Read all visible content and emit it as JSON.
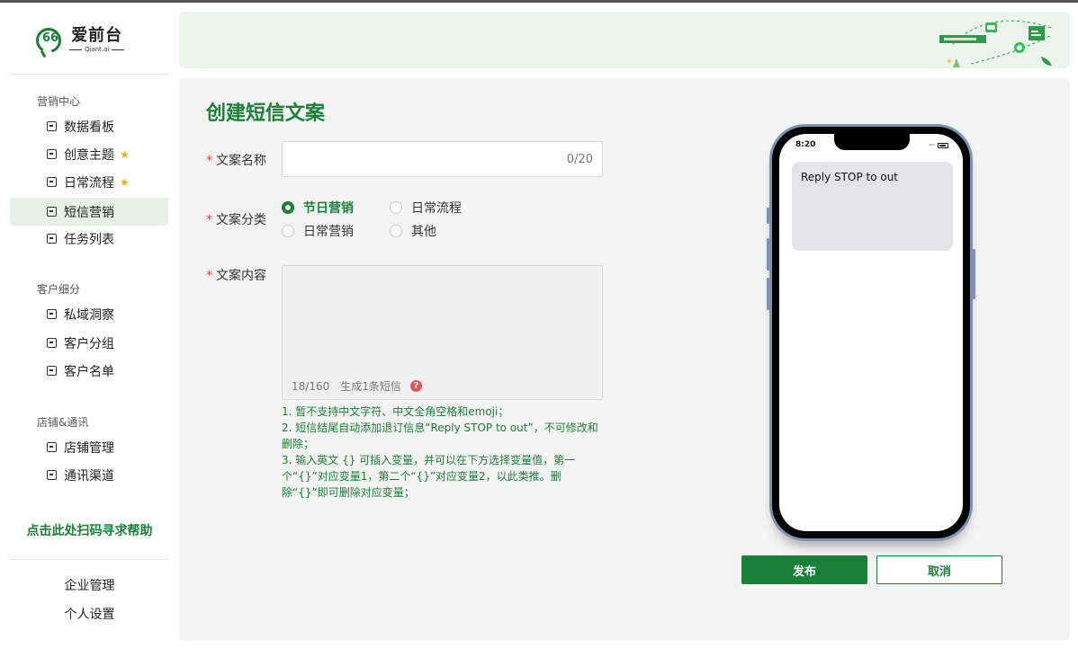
{
  "app": {
    "logo_cn": "爱前台",
    "logo_en": "Qiant.ai",
    "logo_mark": "66"
  },
  "sidebar": {
    "sections": [
      {
        "title": "营销中心",
        "items": [
          {
            "label": "数据看板",
            "icon": "dashboard-icon",
            "starred": false,
            "active": false
          },
          {
            "label": "创意主题",
            "icon": "image-icon",
            "starred": true,
            "active": false
          },
          {
            "label": "日常流程",
            "icon": "calendar-icon",
            "starred": true,
            "active": false
          },
          {
            "label": "短信营销",
            "icon": "sms-icon",
            "starred": false,
            "active": true
          },
          {
            "label": "任务列表",
            "icon": "tasklist-icon",
            "starred": false,
            "active": false
          }
        ]
      },
      {
        "title": "客户细分",
        "items": [
          {
            "label": "私域洞察",
            "icon": "insight-icon"
          },
          {
            "label": "客户分组",
            "icon": "group-icon"
          },
          {
            "label": "客户名单",
            "icon": "customer-list-icon"
          }
        ]
      },
      {
        "title": "店铺&通讯",
        "items": [
          {
            "label": "店铺管理",
            "icon": "store-icon"
          },
          {
            "label": "通讯渠道",
            "icon": "channel-icon"
          }
        ]
      }
    ],
    "help_link": "点击此处扫码寻求帮助",
    "bottom_items": [
      "企业管理",
      "个人设置"
    ]
  },
  "form": {
    "title": "创建短信文案",
    "name_label": "文案名称",
    "name_value": "",
    "name_counter": "0/20",
    "category_label": "文案分类",
    "category_options": [
      "节日营销",
      "日常流程",
      "日常营销",
      "其他"
    ],
    "category_selected": "节日营销",
    "content_label": "文案内容",
    "content_value": "",
    "content_counter": "18/160",
    "content_sms_count": "生成1条短信",
    "notes": [
      "1. 暂不支持中文字符、中文全角空格和emoji；",
      "2. 短信结尾自动添加退订信息“Reply STOP to out”，不可修改和删除；",
      "3. 输入英文 {} 可插入变量，并可以在下方选择变量值，第一个“{}”对应变量1，第二个“{}”对应变量2，以此类推。删除“{}”即可删除对应变量；"
    ]
  },
  "preview": {
    "time": "8:20",
    "signal": "····",
    "message": "Reply STOP to out"
  },
  "actions": {
    "publish": "发布",
    "cancel": "取消"
  },
  "colors": {
    "brand": "#1a7f37",
    "active_bg": "#e7f1e8",
    "star": "#f5a623",
    "required": "#e04545"
  }
}
